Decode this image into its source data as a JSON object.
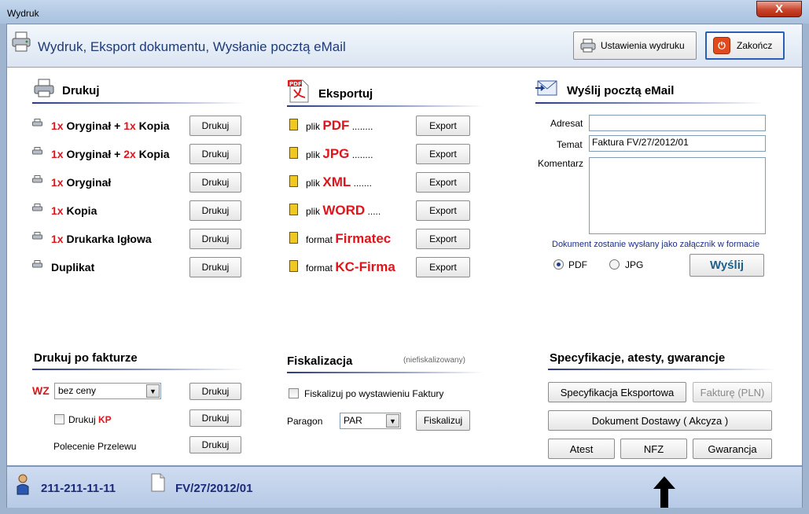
{
  "window": {
    "title": "Wydruk",
    "close_glyph": "X"
  },
  "header": {
    "title": "Wydruk,  Eksport dokumentu,  Wysłanie pocztą eMail",
    "settings_button": "Ustawienia wydruku",
    "close_button": "Zakończ"
  },
  "print": {
    "title": "Drukuj",
    "button": "Drukuj",
    "rows": [
      {
        "n1": "1x",
        "t1": " Oryginał + ",
        "n2": "1x",
        "t2": " Kopia"
      },
      {
        "n1": "1x",
        "t1": " Oryginał + ",
        "n2": "2x",
        "t2": " Kopia"
      },
      {
        "n1": "1x",
        "t1": " Oryginał",
        "n2": "",
        "t2": ""
      },
      {
        "n1": "1x",
        "t1": " Kopia",
        "n2": "",
        "t2": ""
      },
      {
        "n1": "1x",
        "t1": " Drukarka Igłowa",
        "n2": "",
        "t2": ""
      },
      {
        "n1": "",
        "t1": "Duplikat",
        "n2": "",
        "t2": ""
      }
    ]
  },
  "export": {
    "title": "Eksportuj",
    "button": "Export",
    "rows": [
      {
        "prefix": "plik",
        "name": "PDF",
        "dots": "........"
      },
      {
        "prefix": "plik",
        "name": "JPG",
        "dots": "........"
      },
      {
        "prefix": "plik",
        "name": "XML",
        "dots": "......."
      },
      {
        "prefix": "plik",
        "name": "WORD",
        "dots": "....."
      },
      {
        "prefix": "format",
        "name": "Firmatec",
        "dots": ""
      },
      {
        "prefix": "format",
        "name": "KC-Firma",
        "dots": ""
      }
    ]
  },
  "email": {
    "title": "Wyślij pocztą eMail",
    "address_label": "Adresat",
    "address_value": "",
    "subject_label": "Temat",
    "subject_value": "Faktura FV/27/2012/01",
    "comment_label": "Komentarz",
    "comment_value": "",
    "note": "Dokument zostanie wysłany jako załącznik w formacie",
    "format_options": [
      "PDF",
      "JPG"
    ],
    "format_selected": "PDF",
    "send_button": "Wyślij"
  },
  "after_invoice": {
    "title": "Drukuj po fakturze",
    "wz_label": "WZ",
    "wz_select": "bez ceny",
    "kp_label": "Drukuj ",
    "kp_red": "KP",
    "kp_checked": false,
    "transfer_label": "Polecenie Przelewu",
    "button": "Drukuj"
  },
  "fiscal": {
    "title": "Fiskalizacja",
    "status": "(niefiskalizowany)",
    "checkbox_label": "Fiskalizuj po wystawieniu  Faktury",
    "checkbox_checked": false,
    "receipt_label": "Paragon",
    "receipt_select": "PAR",
    "button": "Fiskalizuj"
  },
  "specs": {
    "title": "Specyfikacje, atesty, gwarancje",
    "export_spec_button": "Specyfikacja Eksportowa",
    "invoice_pln_button": "Fakturę (PLN)",
    "delivery_doc_button": "Dokument Dostawy ( Akcyza )",
    "atest_button": "Atest",
    "nfz_button": "NFZ",
    "warranty_button": "Gwarancja"
  },
  "footer": {
    "nip": "211-211-11-11",
    "doc_number": "FV/27/2012/01"
  },
  "colors": {
    "accent_red": "#e0141b",
    "title_blue": "#1f3b77",
    "footer_blue": "#1c2a7a"
  }
}
